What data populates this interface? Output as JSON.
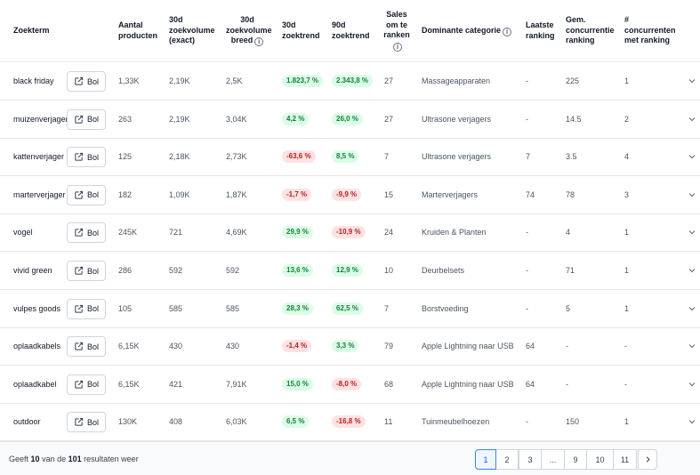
{
  "header": {
    "term": "Zoekterm",
    "products": [
      "Aantal",
      "producten"
    ],
    "vol_exact": [
      "30d",
      "zoekvolume",
      "(exact)"
    ],
    "vol_broad": [
      "30d",
      "zoekvolume",
      "breed"
    ],
    "trend30": [
      "30d",
      "zoektrend"
    ],
    "trend90": [
      "90d",
      "zoektrend"
    ],
    "sales_to_rank": [
      "Sales",
      "om te",
      "ranken"
    ],
    "category": "Dominante categorie",
    "last_ranking": [
      "Laatste",
      "ranking"
    ],
    "avg_comp": [
      "Gem.",
      "concurrentie",
      "ranking"
    ],
    "num_comp": [
      "#",
      "concurrenten",
      "met ranking"
    ]
  },
  "bol_label": "Bol",
  "rows": [
    {
      "term": "black friday",
      "products": "1,33K",
      "vol_exact": "2,19K",
      "vol_broad": "2,5K",
      "trend30": "1.823,7 %",
      "trend30_dir": "pos",
      "trend90": "2.343,8 %",
      "trend90_dir": "pos",
      "sales": "27",
      "category": "Massageapparaten",
      "last": "-",
      "avg": "225",
      "num": "1"
    },
    {
      "term": "muizenverjager",
      "products": "263",
      "vol_exact": "2,19K",
      "vol_broad": "3,04K",
      "trend30": "4,2 %",
      "trend30_dir": "pos",
      "trend90": "26,0 %",
      "trend90_dir": "pos",
      "sales": "27",
      "category": "Ultrasone verjagers",
      "last": "-",
      "avg": "14.5",
      "num": "2"
    },
    {
      "term": "kattenverjager",
      "products": "125",
      "vol_exact": "2,18K",
      "vol_broad": "2,73K",
      "trend30": "-63,6 %",
      "trend30_dir": "neg",
      "trend90": "8,5 %",
      "trend90_dir": "pos",
      "sales": "7",
      "category": "Ultrasone verjagers",
      "last": "7",
      "avg": "3.5",
      "num": "4"
    },
    {
      "term": "marterverjager",
      "products": "182",
      "vol_exact": "1,09K",
      "vol_broad": "1,87K",
      "trend30": "-1,7 %",
      "trend30_dir": "neg",
      "trend90": "-9,9 %",
      "trend90_dir": "neg",
      "sales": "15",
      "category": "Marterverjagers",
      "last": "74",
      "avg": "78",
      "num": "3"
    },
    {
      "term": "vogel",
      "products": "245K",
      "vol_exact": "721",
      "vol_broad": "4,69K",
      "trend30": "29,9 %",
      "trend30_dir": "pos",
      "trend90": "-10,9 %",
      "trend90_dir": "neg",
      "sales": "24",
      "category": "Kruiden & Planten",
      "last": "-",
      "avg": "4",
      "num": "1"
    },
    {
      "term": "vivid green",
      "products": "286",
      "vol_exact": "592",
      "vol_broad": "592",
      "trend30": "13,6 %",
      "trend30_dir": "pos",
      "trend90": "12,9 %",
      "trend90_dir": "pos",
      "sales": "10",
      "category": "Deurbelsets",
      "last": "-",
      "avg": "71",
      "num": "1"
    },
    {
      "term": "vulpes goods",
      "products": "105",
      "vol_exact": "585",
      "vol_broad": "585",
      "trend30": "28,3 %",
      "trend30_dir": "pos",
      "trend90": "62,5 %",
      "trend90_dir": "pos",
      "sales": "7",
      "category": "Borstvoeding",
      "last": "-",
      "avg": "5",
      "num": "1"
    },
    {
      "term": "oplaadkabels",
      "products": "6,15K",
      "vol_exact": "430",
      "vol_broad": "430",
      "trend30": "-1,4 %",
      "trend30_dir": "neg",
      "trend90": "3,3 %",
      "trend90_dir": "pos",
      "sales": "79",
      "category": "Apple Lightning naar USB",
      "last": "64",
      "avg": "-",
      "num": "-"
    },
    {
      "term": "oplaadkabel",
      "products": "6,15K",
      "vol_exact": "421",
      "vol_broad": "7,91K",
      "trend30": "15,0 %",
      "trend30_dir": "pos",
      "trend90": "-8,0 %",
      "trend90_dir": "neg",
      "sales": "68",
      "category": "Apple Lightning naar USB",
      "last": "64",
      "avg": "-",
      "num": "-"
    },
    {
      "term": "outdoor",
      "products": "130K",
      "vol_exact": "408",
      "vol_broad": "6,03K",
      "trend30": "6,5 %",
      "trend30_dir": "pos",
      "trend90": "-16,8 %",
      "trend90_dir": "neg",
      "sales": "11",
      "category": "Tuinmeubelhoezen",
      "last": "-",
      "avg": "150",
      "num": "1"
    }
  ],
  "footer": {
    "prefix": "Geeft",
    "shown": "10",
    "middle": "van de",
    "total": "101",
    "suffix": "resultaten weer"
  },
  "pagination": [
    "1",
    "2",
    "3",
    "...",
    "9",
    "10",
    "11"
  ],
  "colors": {
    "positive_bg": "#dcfce7",
    "positive_text": "#15803d",
    "negative_bg": "#fee2e2",
    "negative_text": "#b91c1c",
    "active_page": "#3b82f6"
  }
}
